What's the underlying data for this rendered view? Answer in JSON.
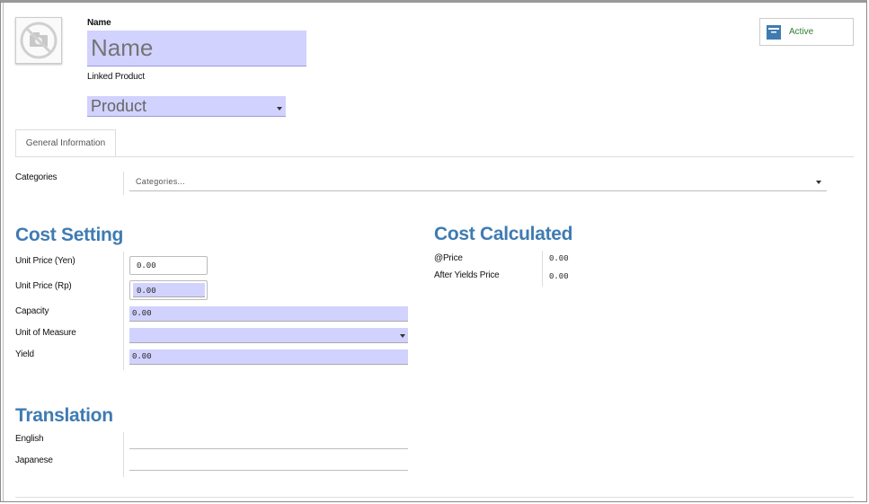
{
  "header": {
    "name_label": "Name",
    "name_placeholder": "Name",
    "linked_product_label": "Linked Product",
    "product_value": "Product",
    "active_label": "Active"
  },
  "tabs": [
    {
      "label": "General Information"
    }
  ],
  "categories": {
    "label": "Categories",
    "placeholder": "Categories..."
  },
  "cost_setting": {
    "title": "Cost Setting",
    "fields": [
      {
        "label": "Unit Price (Yen)",
        "value": "0.00"
      },
      {
        "label": "Unit Price (Rp)",
        "value": "0.00"
      },
      {
        "label": "Capacity",
        "value": "0.00"
      },
      {
        "label": "Unit of Measure",
        "value": ""
      },
      {
        "label": "Yield",
        "value": "0.00"
      }
    ]
  },
  "cost_calculated": {
    "title": "Cost Calculated",
    "fields": [
      {
        "label": "@Price",
        "value": "0.00"
      },
      {
        "label": "After Yields Price",
        "value": "0.00"
      }
    ]
  },
  "translation": {
    "title": "Translation",
    "fields": [
      {
        "label": "English",
        "value": ""
      },
      {
        "label": "Japanese",
        "value": ""
      }
    ]
  },
  "colors": {
    "accent": "#3f7bb2",
    "required_field": "#d2d2fe",
    "active_green": "#2e7d32"
  },
  "icons": {
    "avatar": "no-photo-camera-icon",
    "active": "archive-box-icon",
    "dropdown": "caret-down-icon"
  }
}
